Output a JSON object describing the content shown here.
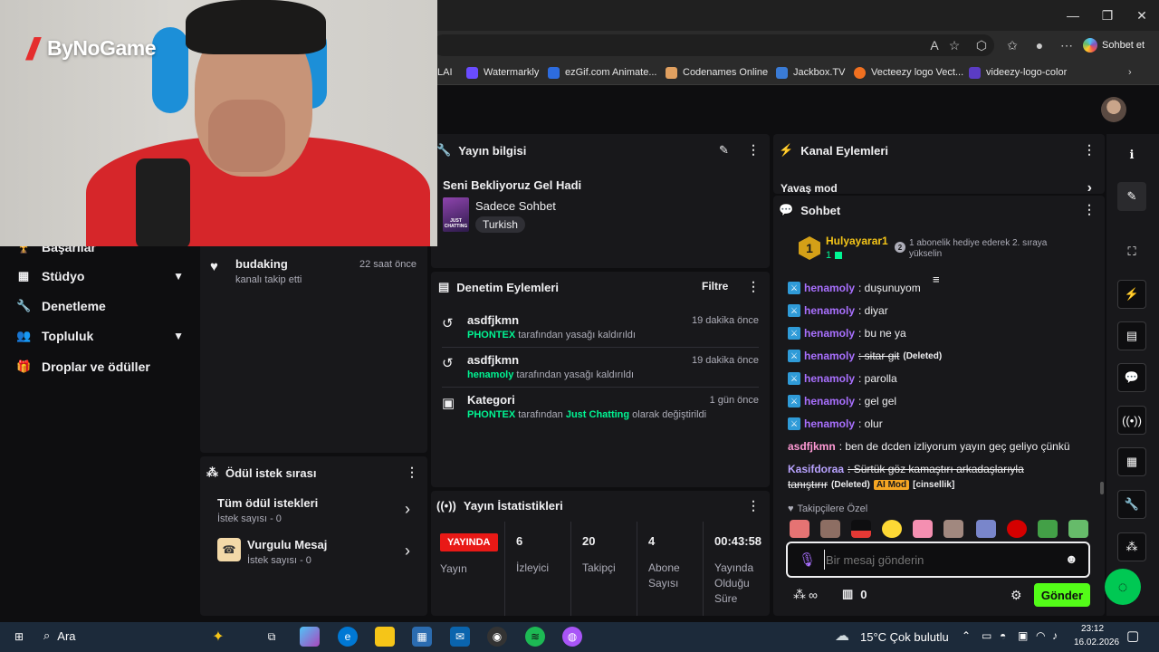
{
  "browser": {
    "copilot_label": "Sohbet et",
    "bookmarks": [
      {
        "label": "LAI",
        "color": "#333333"
      },
      {
        "label": "Watermarkly",
        "color": "#6a4cff"
      },
      {
        "label": "ezGif.com Animate...",
        "color": "#2d6cdf"
      },
      {
        "label": "Codenames Online",
        "color": "#e0a060"
      },
      {
        "label": "Jackbox.TV",
        "color": "#3a7bd5"
      },
      {
        "label": "Vecteezy logo Vect...",
        "color": "#f07020"
      },
      {
        "label": "videezy-logo-color",
        "color": "#5b3cc4"
      }
    ]
  },
  "webcam": {
    "brand": "ByNoGame"
  },
  "leftnav": {
    "items": [
      {
        "label": "Başarılar",
        "icon": "trophy-icon"
      },
      {
        "label": "Stüdyo",
        "icon": "film-icon"
      },
      {
        "label": "Denetleme",
        "icon": "wrench-icon"
      },
      {
        "label": "Topluluk",
        "icon": "users-icon"
      },
      {
        "label": "Droplar ve ödüller",
        "icon": "gift-icon"
      }
    ]
  },
  "activity": {
    "name": "budaking",
    "sub": "kanalı takip etti",
    "time": "22 saat önce"
  },
  "rewards": {
    "title": "Ödül istek sırası",
    "items": [
      {
        "title": "Tüm ödül istekleri",
        "sub": "İstek sayısı - 0"
      },
      {
        "title": "Vurgulu Mesaj",
        "sub": "İstek sayısı - 0"
      }
    ]
  },
  "stream_info": {
    "title": "Yayın bilgisi",
    "stream_title": "Seni Bekliyoruz Gel Hadi",
    "category": "Sadece Sohbet",
    "language": "Turkish",
    "thumb_text": "JUST CHATTING"
  },
  "moderation": {
    "title": "Denetim Eylemleri",
    "filter": "Filtre",
    "items": [
      {
        "name": "asdfjkmn",
        "actor": "PHONTEX",
        "text": " tarafından yasağı kaldırıldı",
        "time": "19 dakika önce"
      },
      {
        "name": "asdfjkmn",
        "actor": "henamoly",
        "text": " tarafından yasağı kaldırıldı",
        "time": "19 dakika önce"
      },
      {
        "name": "Kategori",
        "actor": "PHONTEX",
        "mid": " tarafından ",
        "highlight": "Just Chatting",
        "text": " olarak değiştirildi",
        "time": "1 gün önce"
      }
    ]
  },
  "stats": {
    "title": "Yayın İstatistikleri",
    "live_badge": "YAYINDA",
    "live_label": "Yayın",
    "columns": [
      {
        "value": "6",
        "label": "İzleyici"
      },
      {
        "value": "20",
        "label": "Takipçi"
      },
      {
        "value": "4",
        "label": "Abone Sayısı"
      },
      {
        "value": "00:43:58",
        "label": "Yayında Olduğu Süre"
      }
    ]
  },
  "channel_actions": {
    "title": "Kanal Eylemleri",
    "item": "Yavaş mod"
  },
  "chat": {
    "title": "Sohbet",
    "leader_name": "Hulyayarar1",
    "leader_rank": "1",
    "leader_count": "1",
    "gift_rank": "2",
    "gift_text": "1 abonelik hediye ederek 2. sıraya yükselin",
    "messages": [
      {
        "user": "henamoly",
        "text": ": duşunuyom"
      },
      {
        "user": "henamoly",
        "text": ": diyar"
      },
      {
        "user": "henamoly",
        "text": ": bu ne ya"
      },
      {
        "user": "henamoly",
        "text": ": sitar git",
        "deleted": "(Deleted)"
      },
      {
        "user": "henamoly",
        "text": ": parolla"
      },
      {
        "user": "henamoly",
        "text": ": gel gel"
      },
      {
        "user": "henamoly",
        "text": ": olur"
      },
      {
        "user": "asdfjkmn",
        "text": ": ben de dcden izliyorum yayın geç geliyo çünkü"
      },
      {
        "user": "Kasifdoraa",
        "text": ": Sürtük göz kamaştırı arkadaşlarıyla",
        "text2": "tanıştırır",
        "deleted": "(Deleted)",
        "tag": "AI Mod",
        "tag2": "[cinsellik]"
      }
    ],
    "followers_only": "Takipçilere Özel",
    "placeholder": "Bir mesaj gönderin",
    "points": "∞",
    "bits": "0",
    "send": "Gönder"
  },
  "taskbar": {
    "search": "Ara",
    "weather": "15°C  Çok bulutlu",
    "time": "23:12",
    "date": "16.02.2026"
  },
  "colors": {
    "accent_green": "#00f593",
    "send_green": "#53fc18",
    "chat_purple": "#a970ff",
    "live_red": "#e91916"
  }
}
